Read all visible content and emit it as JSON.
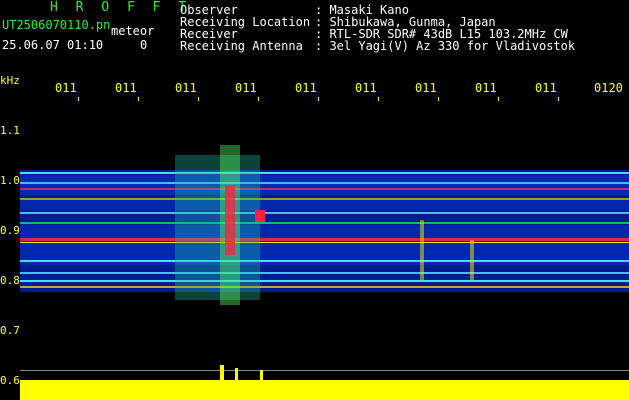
{
  "header": {
    "brand": "H R O F F T",
    "filename": "UT2506070110.pn",
    "meteor_label": "meteor",
    "datetime": "25.06.07 01:10",
    "count": "0",
    "info": [
      {
        "label": "Observer",
        "value": ": Masaki Kano"
      },
      {
        "label": "Receiving Location",
        "value": ": Shibukawa, Gunma, Japan"
      },
      {
        "label": "Receiver",
        "value": ": RTL-SDR SDR# 43dB L15 103.2MHz CW"
      },
      {
        "label": "Receiving Antenna",
        "value": ": 3el Yagi(V) Az 330 for Vladivostok"
      }
    ]
  },
  "axis": {
    "unit": "kHz",
    "y_labels": [
      "1.1",
      "1.0",
      "0.9",
      "0.8",
      "0.7",
      "0.6"
    ],
    "x_labels": [
      "011",
      "011",
      "011",
      "011",
      "011",
      "011",
      "011",
      "011",
      "011",
      "0120"
    ]
  },
  "colors": {
    "text_green": "#33ee33",
    "text_white": "#ffffff",
    "axis_yellow": "#ffff33",
    "noise_floor": "#000a60",
    "signal_red": "#ff2040",
    "signal_yellow": "#ffff00"
  }
}
